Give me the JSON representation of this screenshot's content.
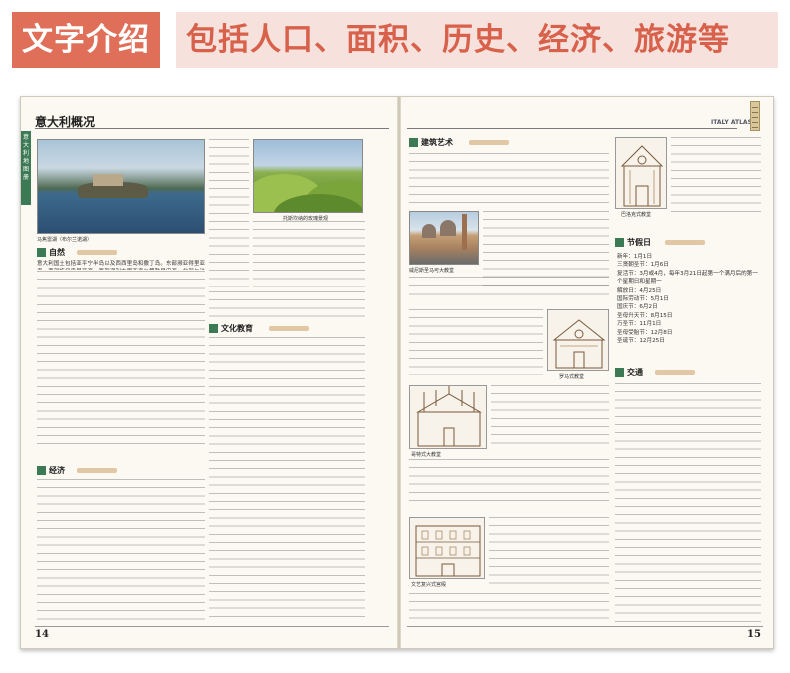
{
  "banner": {
    "tag": "文字介绍",
    "rest": "包括人口、面积、历史、经济、旅游等"
  },
  "left_page": {
    "title": "意大利概况",
    "side_tab": "意大利地图册",
    "photo1_caption": "马焦雷湖（布尔兰诺湖）",
    "photo2_caption": "托斯坎纳的玫瑰景观",
    "sections": [
      "自然",
      "经济",
      "文化教育"
    ],
    "page_number": "14",
    "intro_text": "意大利国土包括亚平宁半岛以及西西里岛和撒丁岛。东部濒亚得里亚海，南部临伊奥尼亚海，西部濒利古里亚海与第勒尼安海。北部与法国、瑞士、奥地利和斯洛文尼亚接壤。"
  },
  "right_page": {
    "atlas": "ITALY ATLAS",
    "sections": [
      "建筑艺术",
      "节假日",
      "交通"
    ],
    "captions": [
      "威尼斯圣马可大教堂",
      "罗马式教堂",
      "哥特式大教堂",
      "文艺复兴式宫殿",
      "巴洛克式教堂"
    ],
    "festivals": [
      "新年：1月1日",
      "三贤朝圣节：1月6日",
      "复活节：3月或4月，每年3月21日起第一个满月后的第一个星期日和星期一",
      "解放日：4月25日",
      "国际劳动节：5月1日",
      "国庆节：6月2日",
      "圣母升天节：8月15日",
      "万圣节：11月1日",
      "圣母受胎节：12月8日",
      "圣诞节：12月25日"
    ],
    "page_number": "15"
  }
}
